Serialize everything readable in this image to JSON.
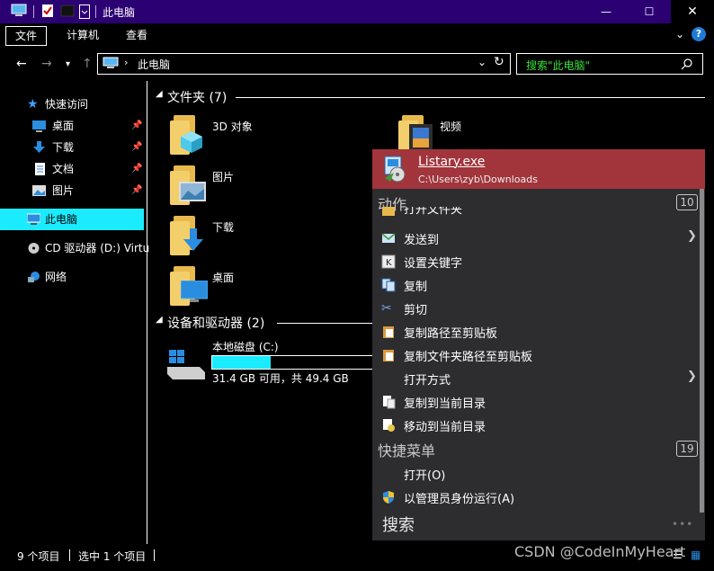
{
  "window": {
    "title": "此电脑",
    "controls": {
      "minimize": "—",
      "maximize": "☐",
      "close": "✕"
    }
  },
  "ribbon": {
    "tabs": [
      {
        "label": "文件"
      },
      {
        "label": "计算机"
      },
      {
        "label": "查看"
      }
    ],
    "help": "?"
  },
  "address": {
    "crumb": "此电脑",
    "search_placeholder": "搜索\"此电脑\""
  },
  "sidebar": {
    "items": [
      {
        "label": "快速访问"
      },
      {
        "label": "桌面"
      },
      {
        "label": "下载"
      },
      {
        "label": "文档"
      },
      {
        "label": "图片"
      },
      {
        "label": "此电脑"
      },
      {
        "label": "CD 驱动器 (D:) Virtu"
      },
      {
        "label": "网络"
      }
    ]
  },
  "folders": {
    "header": "文件夹 (7)",
    "items": [
      {
        "label": "3D 对象"
      },
      {
        "label": "视频"
      },
      {
        "label": "图片"
      },
      {
        "label": "下载"
      },
      {
        "label": "桌面"
      }
    ]
  },
  "devices": {
    "header": "设备和驱动器 (2)",
    "drive_name": "本地磁盘 (C:)",
    "drive_info": "31.4 GB 可用，共 49.4 GB",
    "drive_used_fraction": 0.364
  },
  "status": {
    "count": "9 个项目",
    "selected": "选中 1 个项目"
  },
  "popup": {
    "hit": {
      "name": "Listary.exe",
      "path": "C:\\Users\\zyb\\Downloads"
    },
    "actions_header": "动作",
    "actions_count": "10",
    "actions": [
      {
        "label": "打开文件夹"
      },
      {
        "label": "发送到"
      },
      {
        "label": "设置关键字"
      },
      {
        "label": "复制"
      },
      {
        "label": "剪切"
      },
      {
        "label": "复制路径至剪贴板"
      },
      {
        "label": "复制文件夹路径至剪贴板"
      },
      {
        "label": "打开方式"
      },
      {
        "label": "复制到当前目录"
      },
      {
        "label": "移动到当前目录"
      }
    ],
    "quick_header": "快捷菜单",
    "quick_count": "19",
    "quick": [
      {
        "label": "打开(O)"
      },
      {
        "label": "以管理员身份运行(A)"
      }
    ],
    "search_label": "搜索",
    "more": "•••"
  },
  "watermark": "CSDN @CodeInMyHeart"
}
